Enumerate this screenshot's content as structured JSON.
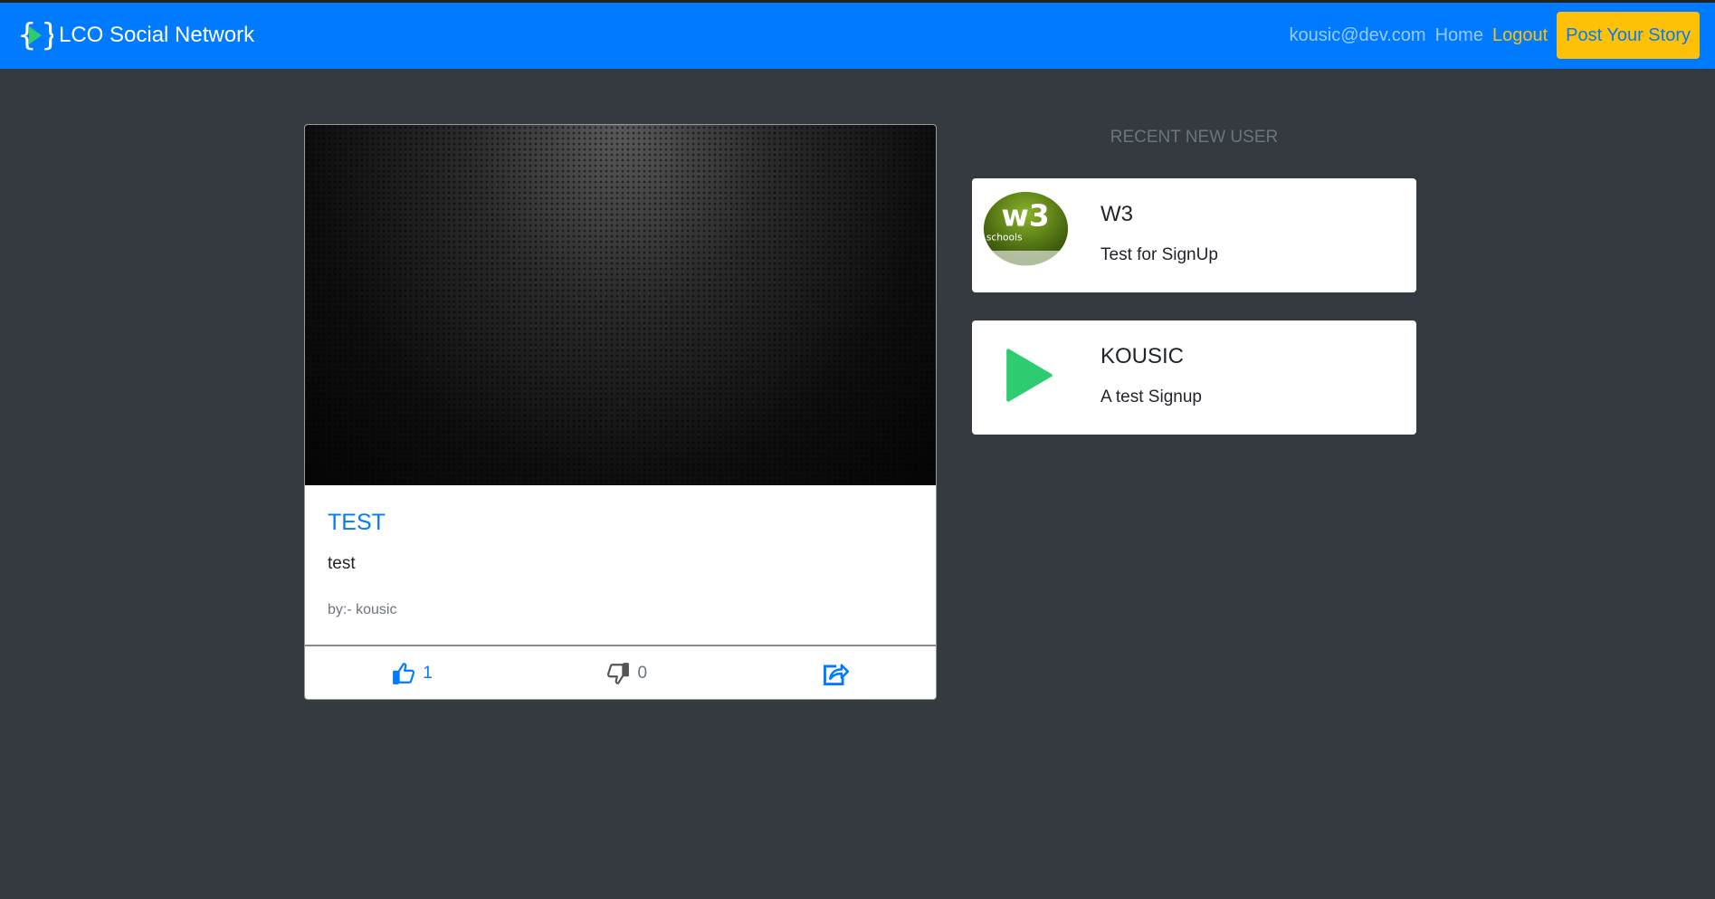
{
  "navbar": {
    "brand": "LCO Social Network",
    "email": "kousic@dev.com",
    "home": "Home",
    "logout": "Logout",
    "post_story": "Post Your Story"
  },
  "post": {
    "title": "TEST",
    "text": "test",
    "author": "by:- kousic",
    "likes": "1",
    "dislikes": "0",
    "icons": {
      "like": "thumbs-up-icon",
      "dislike": "thumbs-down-icon",
      "share": "share-icon"
    }
  },
  "sidebar": {
    "heading": "RECENT NEW USER",
    "users": [
      {
        "name": "W3",
        "description": "Test for SignUp",
        "avatar_text": "w3 schools"
      },
      {
        "name": "KOUSIC",
        "description": "A test Signup"
      }
    ]
  },
  "colors": {
    "primary": "#007bff",
    "warning": "#ffc107",
    "background": "#343a40"
  }
}
